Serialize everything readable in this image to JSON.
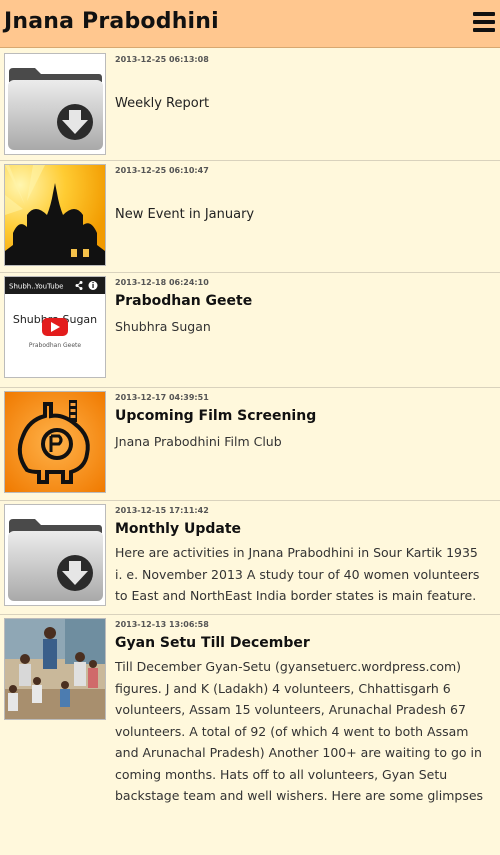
{
  "header": {
    "title": "Jnana Prabodhini",
    "menu_icon": "hamburger-menu-icon",
    "background": "#ffc78f"
  },
  "feed": [
    {
      "timestamp": "2013-12-25 06:13:08",
      "title": "",
      "text": "Weekly Report",
      "thumbnail": "download-folder-icon"
    },
    {
      "timestamp": "2013-12-25 06:10:47",
      "title": "",
      "text": "New Event in January",
      "thumbnail": "temple-silhouette-image"
    },
    {
      "timestamp": "2013-12-18 06:24:10",
      "title": "Prabodhan Geete",
      "text": "Shubhra Sugan",
      "thumbnail": "youtube-video-thumbnail",
      "video": {
        "top_label": "Shubh...",
        "brand": "YouTube",
        "title": "Shubhra Sugan",
        "subtitle": "Prabodhan Geete"
      }
    },
    {
      "timestamp": "2013-12-17 04:39:51",
      "title": "Upcoming Film Screening",
      "text": "Jnana Prabodhini Film Club",
      "thumbnail": "film-club-logo"
    },
    {
      "timestamp": "2013-12-15 17:11:42",
      "title": "Monthly Update",
      "text": "Here are activities in Jnana Prabodhini in Sour Kartik 1935 i. e. November 2013 A study tour of 40 women volunteers to East and NorthEast India border states is main feature.",
      "thumbnail": "download-folder-icon"
    },
    {
      "timestamp": "2013-12-13 13:06:58",
      "title": "Gyan Setu Till December",
      "text": "Till December Gyan-Setu (gyansetuerc.wordpress.com) figures. J and K (Ladakh) 4 volunteers, Chhattisgarh 6 volunteers, Assam 15 volunteers, Arunachal Pradesh 67 volunteers. A total of 92 (of which 4 went to both Assam and Arunachal Pradesh) Another 100+ are waiting to go in coming months. Hats off to all volunteers, Gyan Setu backstage team and well wishers. Here are some glimpses",
      "thumbnail": "classroom-photo"
    }
  ]
}
